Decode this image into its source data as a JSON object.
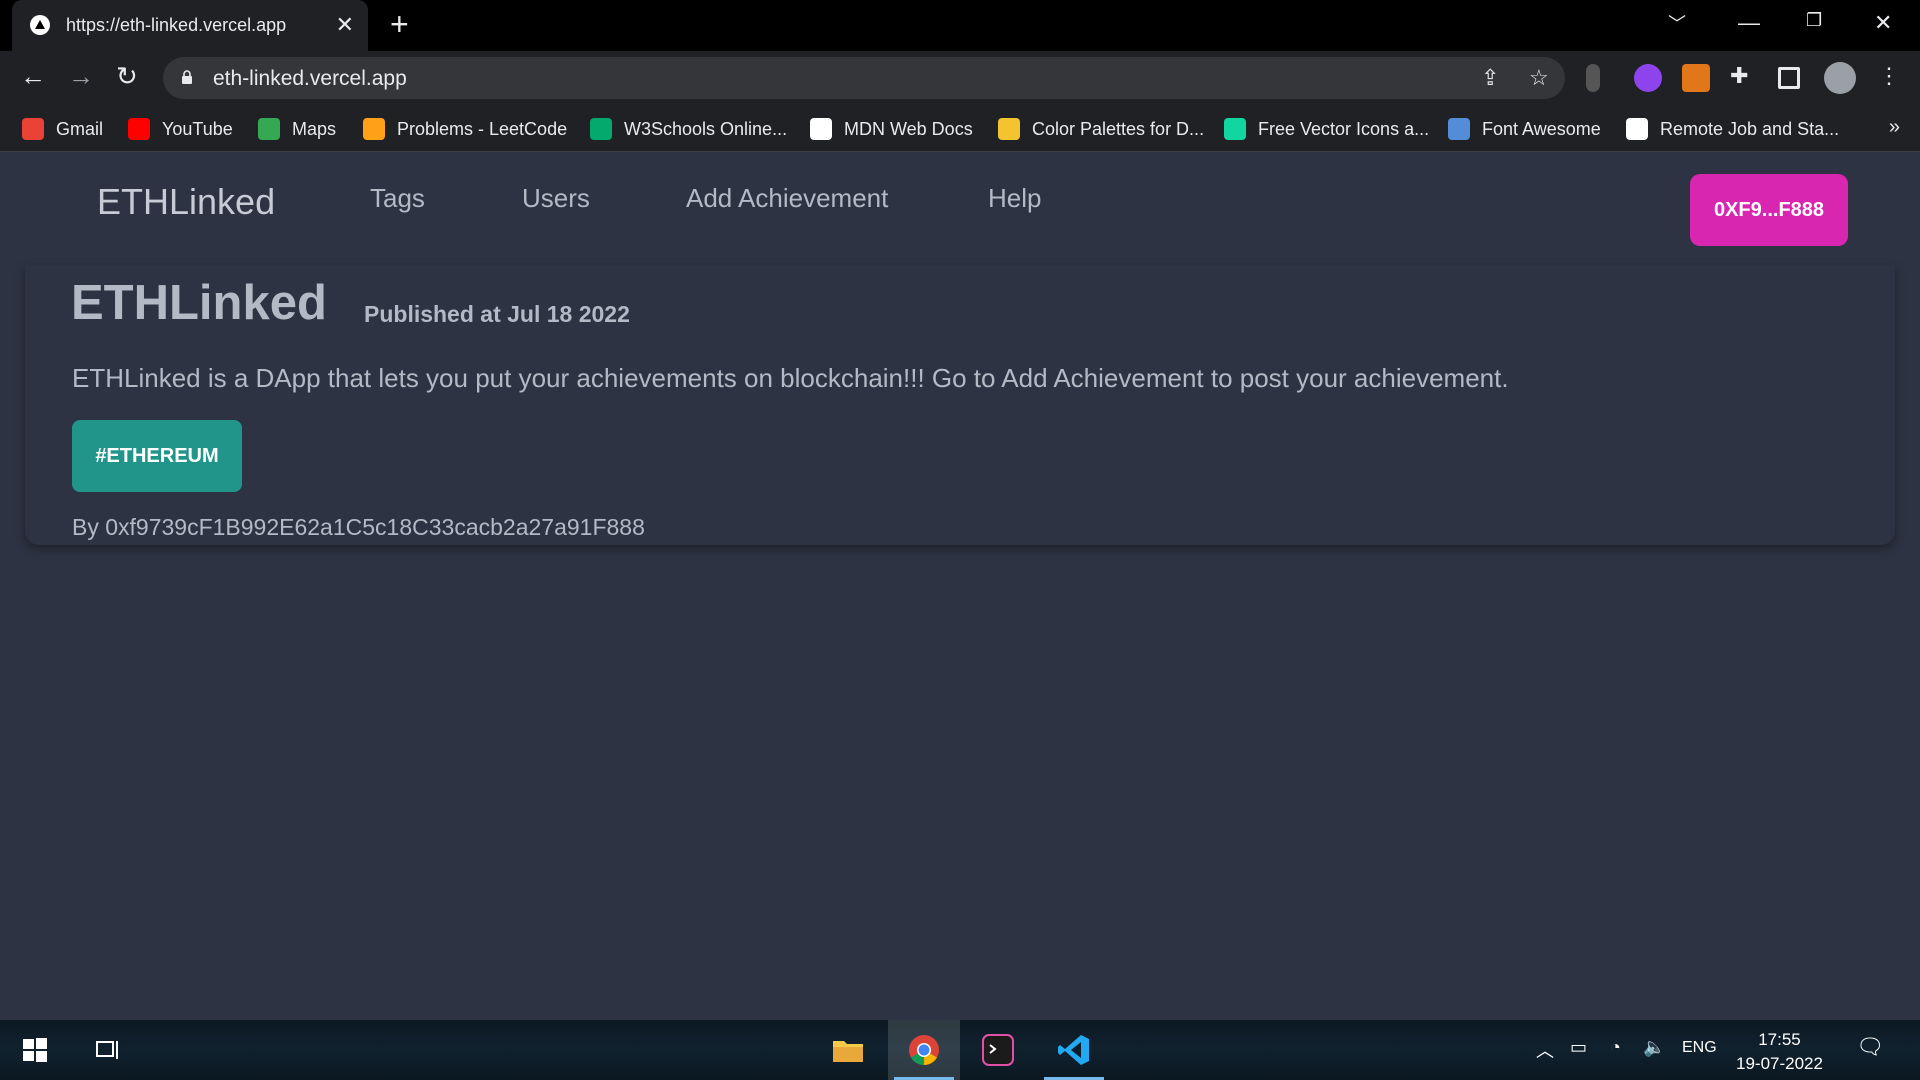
{
  "browser": {
    "tab_title": "https://eth-linked.vercel.app",
    "url": "eth-linked.vercel.app",
    "bookmarks": [
      {
        "label": "Gmail",
        "color": "#ea4335"
      },
      {
        "label": "YouTube",
        "color": "#ff0000"
      },
      {
        "label": "Maps",
        "color": "#34a853"
      },
      {
        "label": "Problems - LeetCode",
        "color": "#ffa116"
      },
      {
        "label": "W3Schools Online...",
        "color": "#04aa6d"
      },
      {
        "label": "MDN Web Docs",
        "color": "#ffffff"
      },
      {
        "label": "Color Palettes for D...",
        "color": "#f4c430"
      },
      {
        "label": "Free Vector Icons a...",
        "color": "#12d6a0"
      },
      {
        "label": "Font Awesome",
        "color": "#538dd7"
      },
      {
        "label": "Remote Job and Sta...",
        "color": "#ffffff"
      }
    ],
    "more_bookmarks": "»"
  },
  "site": {
    "brand": "ETHLinked",
    "nav": [
      "Tags",
      "Users",
      "Add Achievement",
      "Help"
    ],
    "wallet": "0XF9...F888",
    "accent": "#d826b0"
  },
  "post": {
    "title": "ETHLinked",
    "published": "Published at Jul 18 2022",
    "description": "ETHLinked is a DApp that lets you put your achievements on blockchain!!! Go to Add Achievement to post your achievement.",
    "tag": "#ETHEREUM",
    "tag_color": "#22958b",
    "author": "By 0xf9739cF1B992E62a1C5c18C33cacb2a27a91F888"
  },
  "taskbar": {
    "language": "ENG",
    "time": "17:55",
    "date": "19-07-2022"
  }
}
